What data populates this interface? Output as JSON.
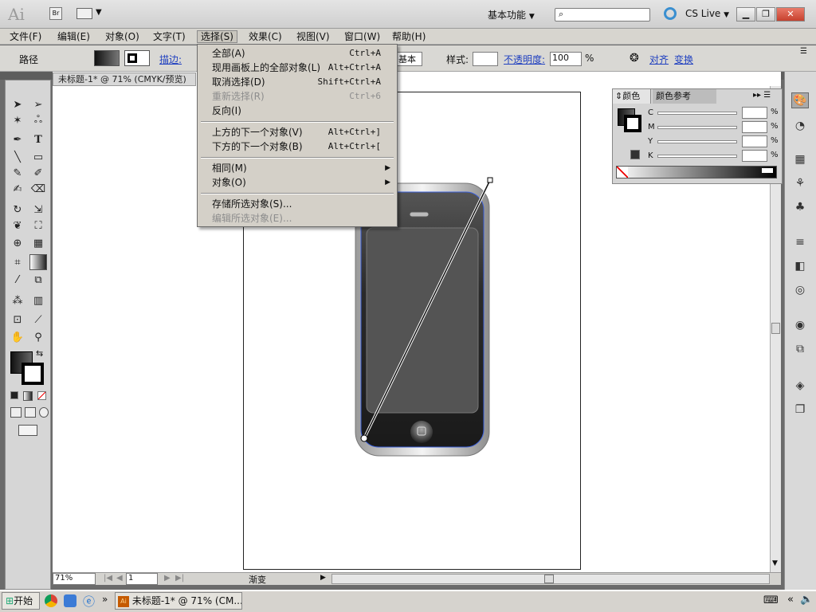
{
  "app": {
    "logo": "Ai",
    "br_label": "Br",
    "workspace": "基本功能",
    "search_placeholder": "",
    "cslive": "CS Live"
  },
  "menu": {
    "items": [
      "文件(F)",
      "编辑(E)",
      "对象(O)",
      "文字(T)",
      "选择(S)",
      "效果(C)",
      "视图(V)",
      "窗口(W)",
      "帮助(H)"
    ],
    "active_index": 4
  },
  "control": {
    "label": "路径",
    "stroke_label": "描边:",
    "basic_label": "基本",
    "style_label": "样式:",
    "opacity_label": "不透明度:",
    "opacity_value": "100",
    "opacity_unit": "%",
    "align_label": "对齐",
    "transform_label": "变换"
  },
  "document": {
    "tab_title": "未标题-1* @ 71% (CMYK/预览)",
    "zoom": "71%",
    "page": "1",
    "status_text": "渐变"
  },
  "select_menu": {
    "items": [
      {
        "label": "全部(A)",
        "shortcut": "Ctrl+A",
        "disabled": false
      },
      {
        "label": "现用画板上的全部对象(L)",
        "shortcut": "Alt+Ctrl+A",
        "disabled": false
      },
      {
        "label": "取消选择(D)",
        "shortcut": "Shift+Ctrl+A",
        "disabled": false
      },
      {
        "label": "重新选择(R)",
        "shortcut": "Ctrl+6",
        "disabled": true
      },
      {
        "label": "反向(I)",
        "shortcut": "",
        "disabled": false
      },
      {
        "label": "上方的下一个对象(V)",
        "shortcut": "Alt+Ctrl+]",
        "disabled": false
      },
      {
        "label": "下方的下一个对象(B)",
        "shortcut": "Alt+Ctrl+[",
        "disabled": false
      },
      {
        "label": "相同(M)",
        "shortcut": "",
        "disabled": false,
        "submenu": true
      },
      {
        "label": "对象(O)",
        "shortcut": "",
        "disabled": false,
        "submenu": true
      },
      {
        "label": "存储所选对象(S)...",
        "shortcut": "",
        "disabled": false
      },
      {
        "label": "编辑所选对象(E)...",
        "shortcut": "",
        "disabled": true
      }
    ]
  },
  "color_panel": {
    "tab_color": "颜色",
    "tab_guide": "颜色参考",
    "channels": [
      "C",
      "M",
      "Y",
      "K"
    ],
    "unit": "%"
  },
  "taskbar": {
    "start": "开始",
    "task": "未标题-1* @ 71% (CM..."
  },
  "colors": {
    "accent": "#4a6fd8",
    "menu_bg": "#d4d0c8",
    "dark": "#6b6b6b"
  }
}
